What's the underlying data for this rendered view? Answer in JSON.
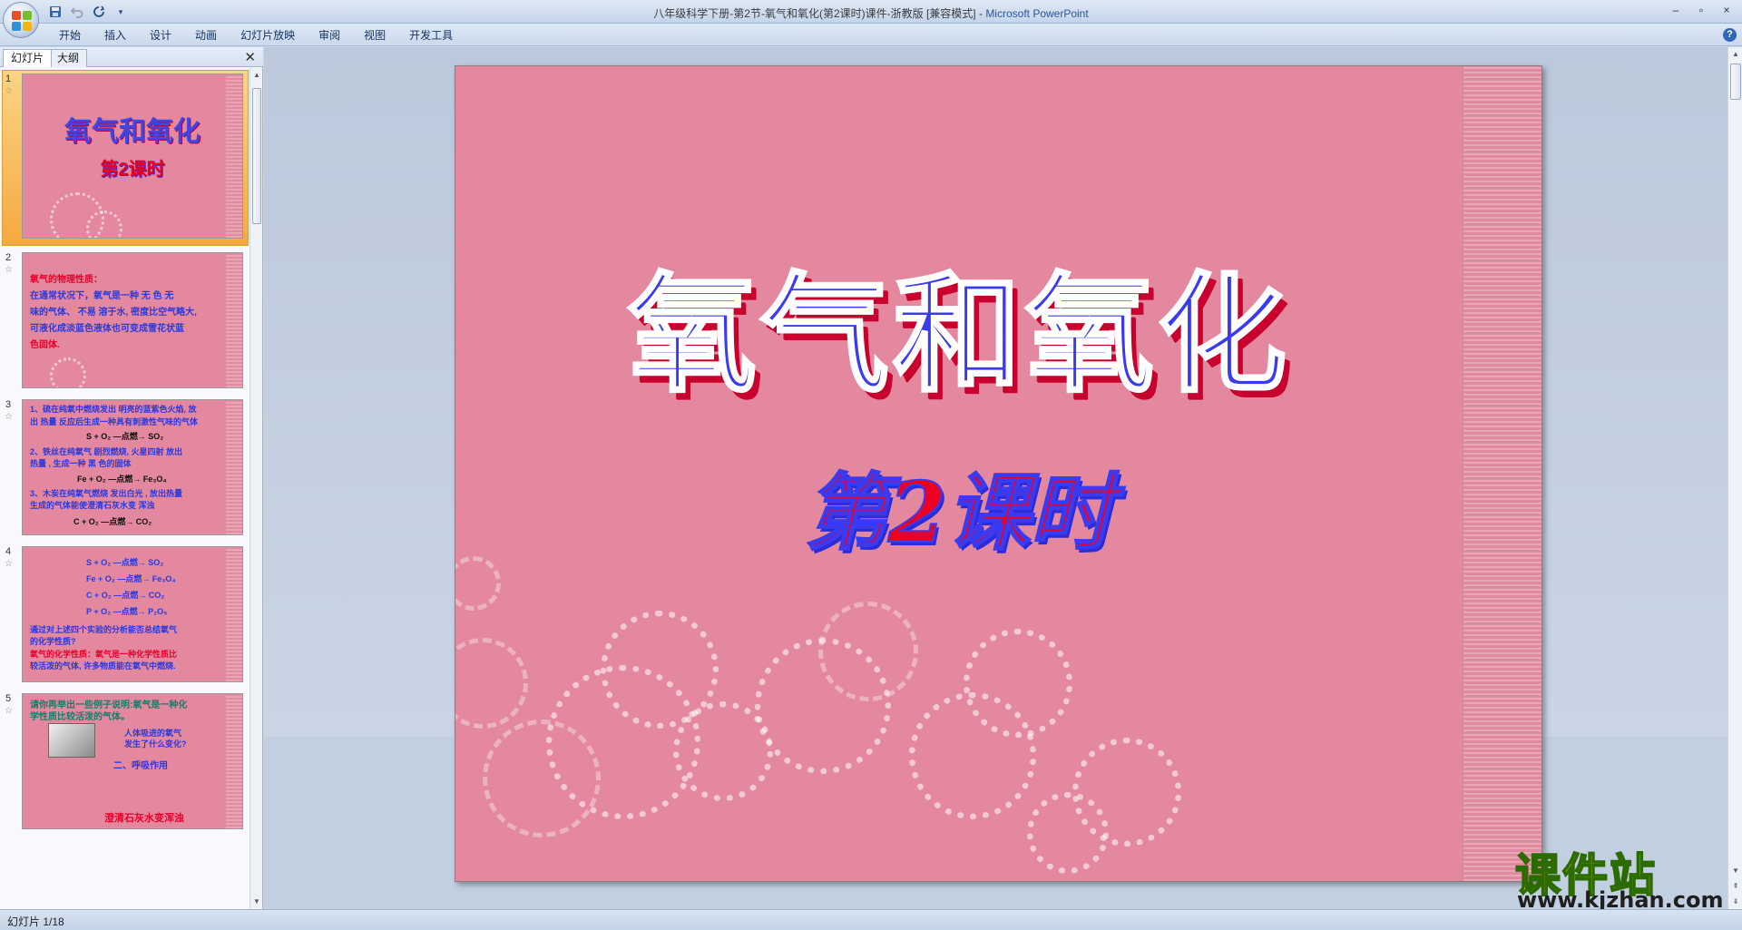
{
  "window": {
    "title": "八年级科学下册-第2节-氧气和氧化(第2课时)课件-浙教版 [兼容模式]",
    "title_sep": " - ",
    "app_name": "Microsoft PowerPoint"
  },
  "quick_access": {
    "icons": [
      "save-icon",
      "undo-icon",
      "redo-icon",
      "customize-icon"
    ]
  },
  "ribbon": {
    "tabs": [
      "开始",
      "插入",
      "设计",
      "动画",
      "幻灯片放映",
      "审阅",
      "视图",
      "开发工具"
    ]
  },
  "left_pane": {
    "tabs": [
      "幻灯片",
      "大纲"
    ],
    "slides": [
      {
        "number": "1",
        "title": "氧气和氧化",
        "subtitle": "第2课时",
        "selected": true
      },
      {
        "number": "2",
        "lines": [
          {
            "text": "氧气的物理性质：",
            "color": "red"
          },
          {
            "text": "在通常状况下，氧气是一种 无 色 无",
            "color": "blue"
          },
          {
            "text": "味的气体、 不易 溶于水, 密度比空气略大,",
            "color": "blue"
          },
          {
            "text": "可液化成淡蓝色液体也可变成雪花状蓝",
            "color": "blue"
          },
          {
            "text": "色固体.",
            "color": "red"
          }
        ]
      },
      {
        "number": "3",
        "lines": [
          {
            "text": "1、硫在纯氧中燃烧发出 明亮的蓝紫色火焰, 放",
            "color": "blue"
          },
          {
            "text": "出 热量 反应后生成一种具有刺激性气味的气体",
            "color": "blue"
          },
          {
            "text": "S + O₂ —点燃→ SO₂",
            "color": "black"
          },
          {
            "text": "2、铁丝在纯氧气 剧烈燃烧, 火星四射 放出",
            "color": "blue"
          },
          {
            "text": "热量 , 生成一种 黑 色的固体",
            "color": "blue"
          },
          {
            "text": "Fe + O₂ —点燃→ Fe₃O₄",
            "color": "black"
          },
          {
            "text": "3、木炭在纯氧气燃烧 发出白光 , 放出热量",
            "color": "blue"
          },
          {
            "text": "生成的气体能使澄清石灰水变 浑浊",
            "color": "blue"
          },
          {
            "text": "C + O₂ —点燃→ CO₂",
            "color": "black"
          }
        ]
      },
      {
        "number": "4",
        "lines": [
          {
            "text": "S + O₂ —点燃→ SO₂",
            "color": "blue"
          },
          {
            "text": "Fe + O₂ —点燃→ Fe₃O₄",
            "color": "blue"
          },
          {
            "text": "C + O₂ —点燃→ CO₂",
            "color": "blue"
          },
          {
            "text": "P + O₂ —点燃→ P₂O₅",
            "color": "blue"
          },
          {
            "text": "通过对上述四个实验的分析能否总结氧气",
            "color": "blue"
          },
          {
            "text": "的化学性质?",
            "color": "blue"
          },
          {
            "text": "氧气的化学性质：氧气是一种化学性质比",
            "color": "red"
          },
          {
            "text": "较活泼的气体, 许多物质能在氧气中燃烧.",
            "color": "blue"
          }
        ]
      },
      {
        "number": "5",
        "lines": [
          {
            "text": "请你再举出一些例子说明:氧气是一种化",
            "color": "green"
          },
          {
            "text": "学性质比较活泼的气体。",
            "color": "green"
          },
          {
            "text": "人体吸进的氧气",
            "color": "blue"
          },
          {
            "text": "发生了什么变化?",
            "color": "blue"
          },
          {
            "text": "二、呼吸作用",
            "color": "blue"
          },
          {
            "text": "澄清石灰水变浑浊",
            "color": "red"
          }
        ]
      }
    ]
  },
  "slide": {
    "title": "氧气和氧化",
    "subtitle": "第2课时"
  },
  "watermark": {
    "name": "课件站",
    "url": "www.kjzhan.com"
  },
  "status_bar": {
    "slide_counter": "幻灯片 1/18"
  },
  "colors": {
    "slide_bg": "#e3889f",
    "title_blue": "#3a3af0",
    "title_shadow_red": "#c8002d",
    "ribbon_bg": "#dde8f6"
  }
}
